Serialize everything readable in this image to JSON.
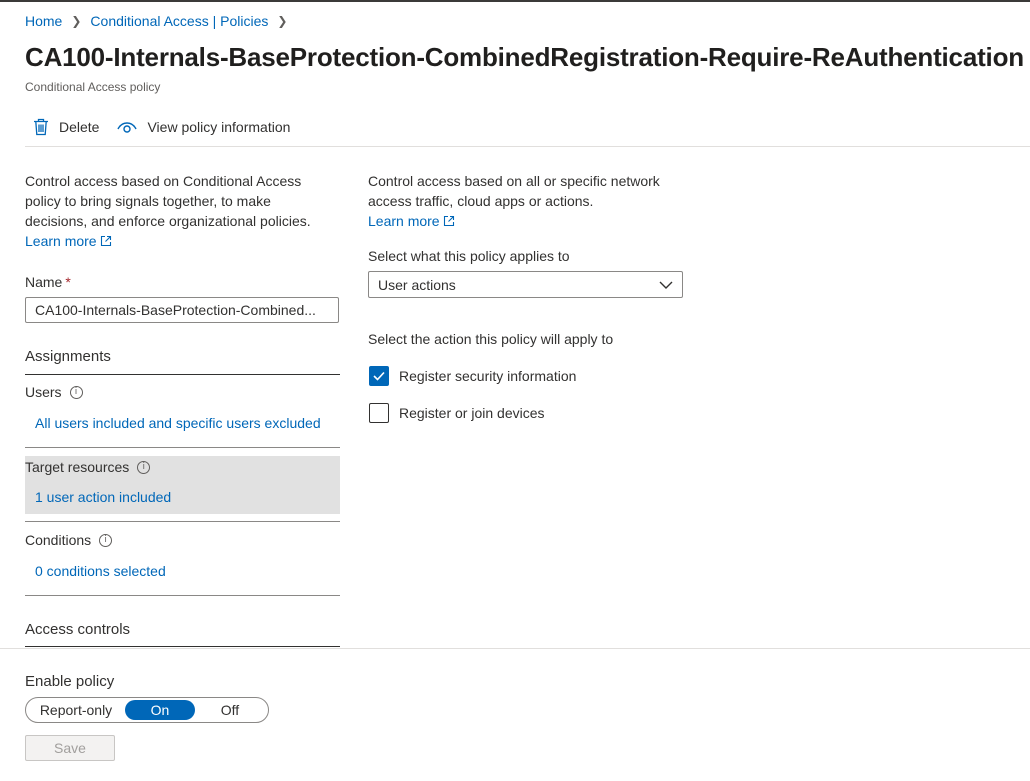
{
  "breadcrumb": {
    "home": "Home",
    "policies": "Conditional Access | Policies"
  },
  "page": {
    "title": "CA100-Internals-BaseProtection-CombinedRegistration-Require-ReAuthentication",
    "subtitle": "Conditional Access policy"
  },
  "toolbar": {
    "delete_label": "Delete",
    "view_label": "View policy information"
  },
  "left": {
    "description": "Control access based on Conditional Access policy to bring signals together, to make decisions, and enforce organizational policies.",
    "learn_more": "Learn more",
    "name_label": "Name",
    "name_required": "*",
    "name_value": "CA100-Internals-BaseProtection-Combined...",
    "assignments_header": "Assignments",
    "users_label": "Users",
    "users_value": "All users included and specific users excluded",
    "target_label": "Target resources",
    "target_value": "1 user action included",
    "conditions_label": "Conditions",
    "conditions_value": "0 conditions selected",
    "access_controls_header": "Access controls"
  },
  "right": {
    "description": "Control access based on all or specific network access traffic, cloud apps or actions.",
    "learn_more": "Learn more",
    "applies_label": "Select what this policy applies to",
    "applies_value": "User actions",
    "action_label": "Select the action this policy will apply to",
    "actions": [
      {
        "label": "Register security information",
        "checked": true
      },
      {
        "label": "Register or join devices",
        "checked": false
      }
    ]
  },
  "enable_policy": {
    "label": "Enable policy",
    "options": [
      "Report-only",
      "On",
      "Off"
    ],
    "selected": "On"
  },
  "save_label": "Save",
  "colors": {
    "accent": "#0067b8",
    "required": "#a4262c",
    "selected_bg": "#e1e1e1"
  },
  "icons": {
    "delete": "trash-icon",
    "view": "eye-icon",
    "external": "external-link-icon",
    "info": "info-icon",
    "dropdown": "chevron-down-icon",
    "check": "checkmark-icon"
  }
}
